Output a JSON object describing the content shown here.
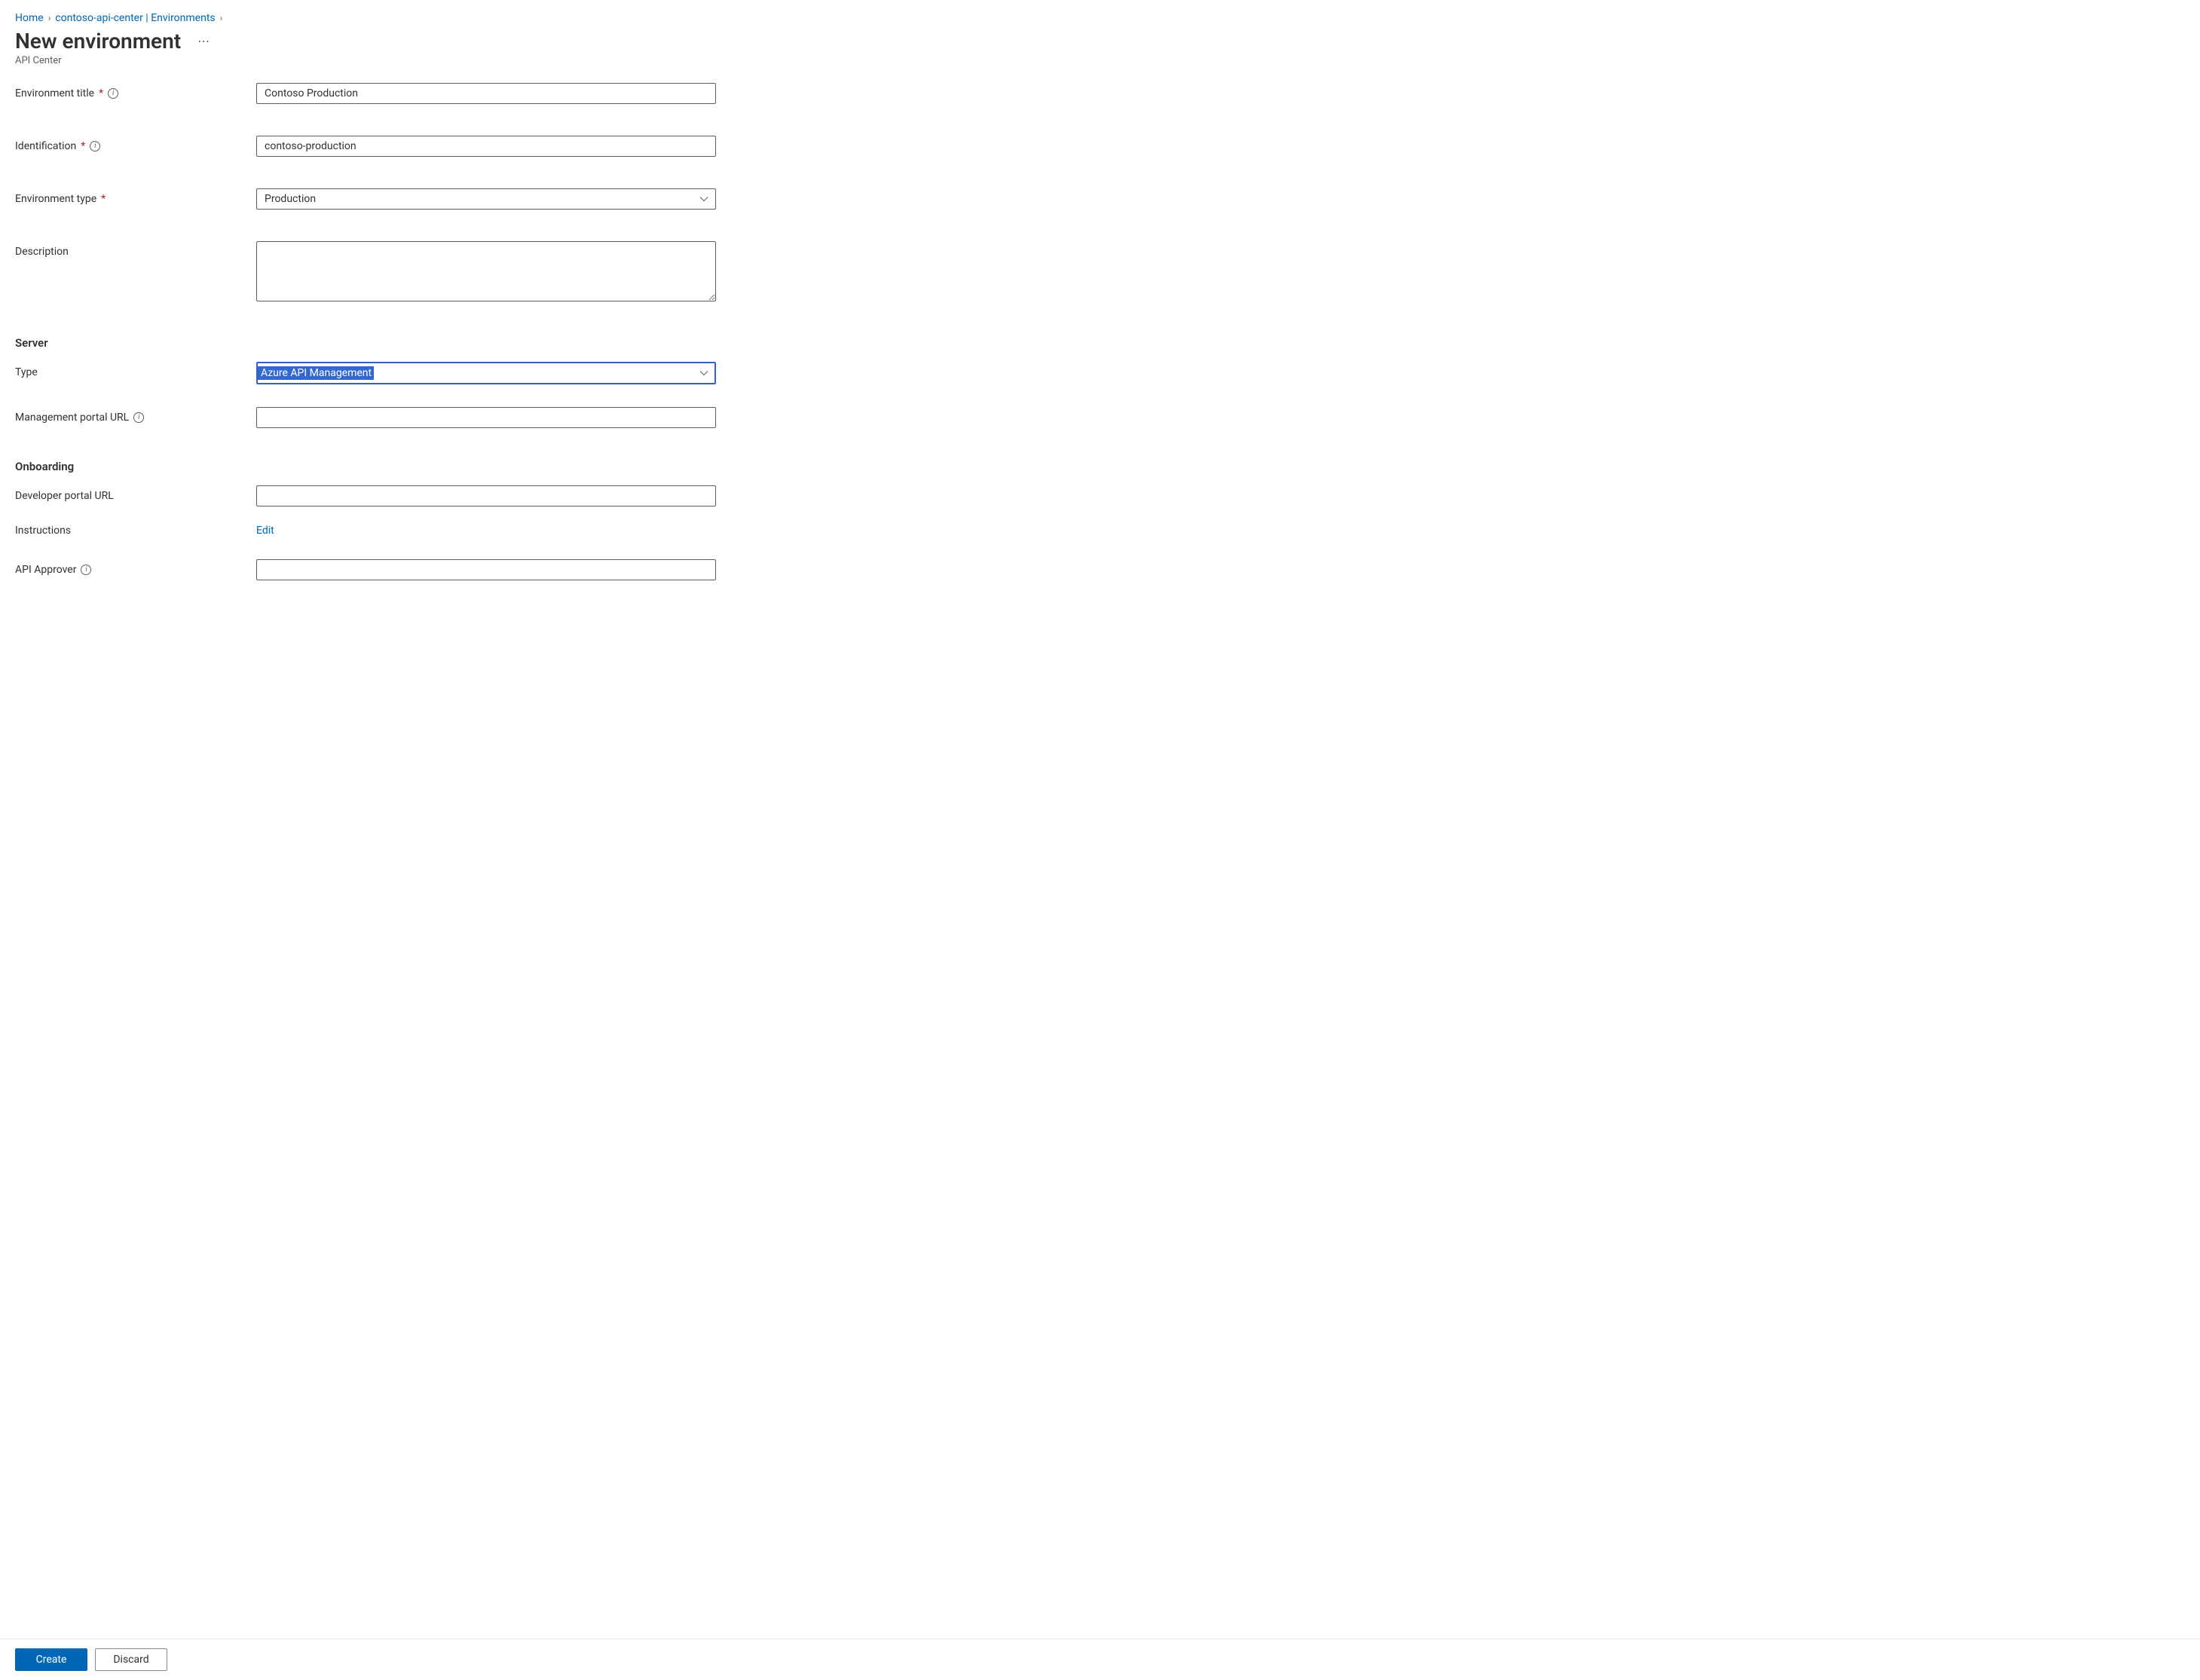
{
  "breadcrumb": {
    "home": "Home",
    "resource": "contoso-api-center | Environments"
  },
  "header": {
    "title": "New environment",
    "subtitle": "API Center"
  },
  "form": {
    "env_title": {
      "label": "Environment title",
      "value": "Contoso Production",
      "required": true,
      "info": true
    },
    "identification": {
      "label": "Identification",
      "value": "contoso-production",
      "required": true,
      "info": true
    },
    "env_type": {
      "label": "Environment type",
      "value": "Production",
      "required": true
    },
    "description": {
      "label": "Description",
      "value": ""
    }
  },
  "sections": {
    "server": {
      "title": "Server",
      "type": {
        "label": "Type",
        "value": "Azure API Management"
      },
      "mgmt_url": {
        "label": "Management portal URL",
        "value": "",
        "info": true
      }
    },
    "onboarding": {
      "title": "Onboarding",
      "dev_url": {
        "label": "Developer portal URL",
        "value": ""
      },
      "instructions": {
        "label": "Instructions",
        "action": "Edit"
      },
      "approver": {
        "label": "API Approver",
        "value": "",
        "info": true
      }
    }
  },
  "footer": {
    "create": "Create",
    "discard": "Discard"
  }
}
